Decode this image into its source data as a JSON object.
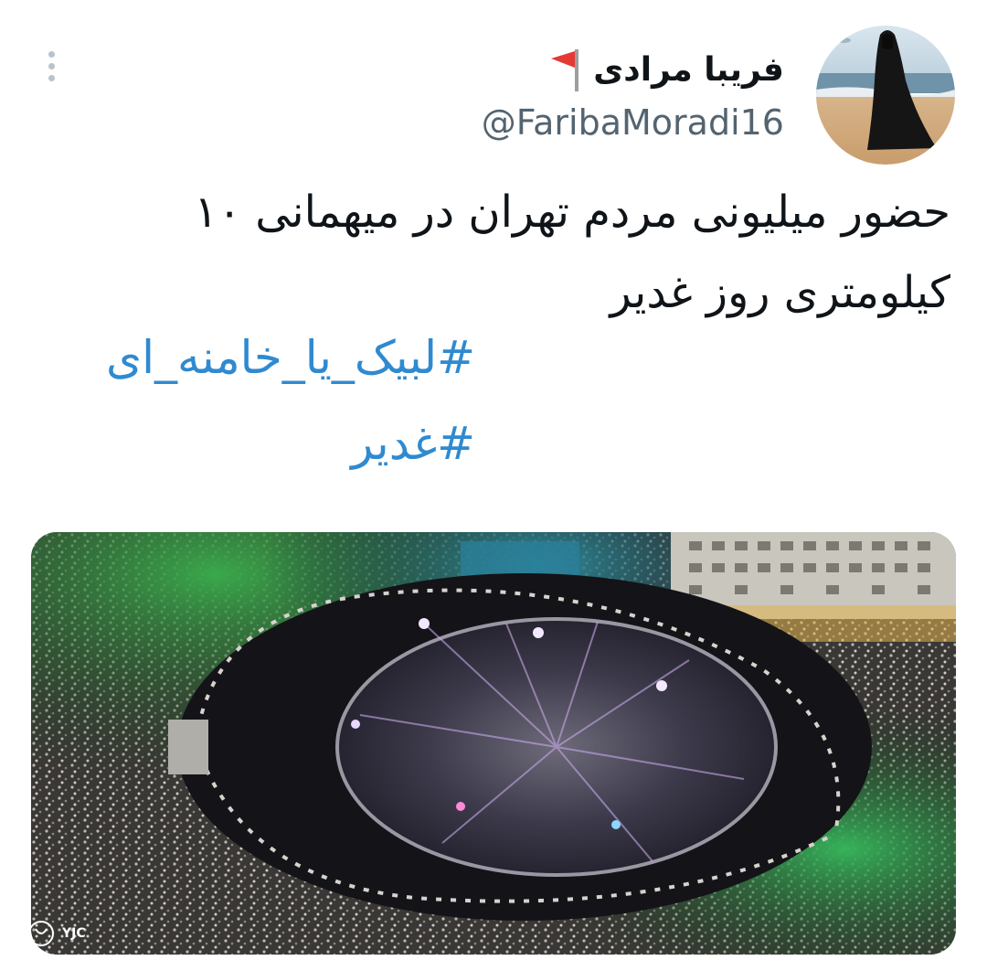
{
  "author": {
    "display_name": "فریبا مرادی",
    "handle": "@FaribaMoradi16",
    "flag_icon": "red-flag-icon",
    "avatar_icon": "profile-photo"
  },
  "tweet": {
    "text": "حضور میلیونی مردم تهران در میهمانی ۱۰ کیلومتری روز غدیر",
    "hashtags": [
      "#لبیک_یا_خامنه_ای",
      "#غدیر"
    ]
  },
  "media": {
    "description_icon": "aerial-crowd-photo",
    "watermark": "YJC"
  },
  "colors": {
    "hashtag": "#2f8ad0",
    "handle": "#536471",
    "text": "#0f1419",
    "flag": "#e53935"
  },
  "icons": {
    "more": "more-vertical-icon"
  }
}
